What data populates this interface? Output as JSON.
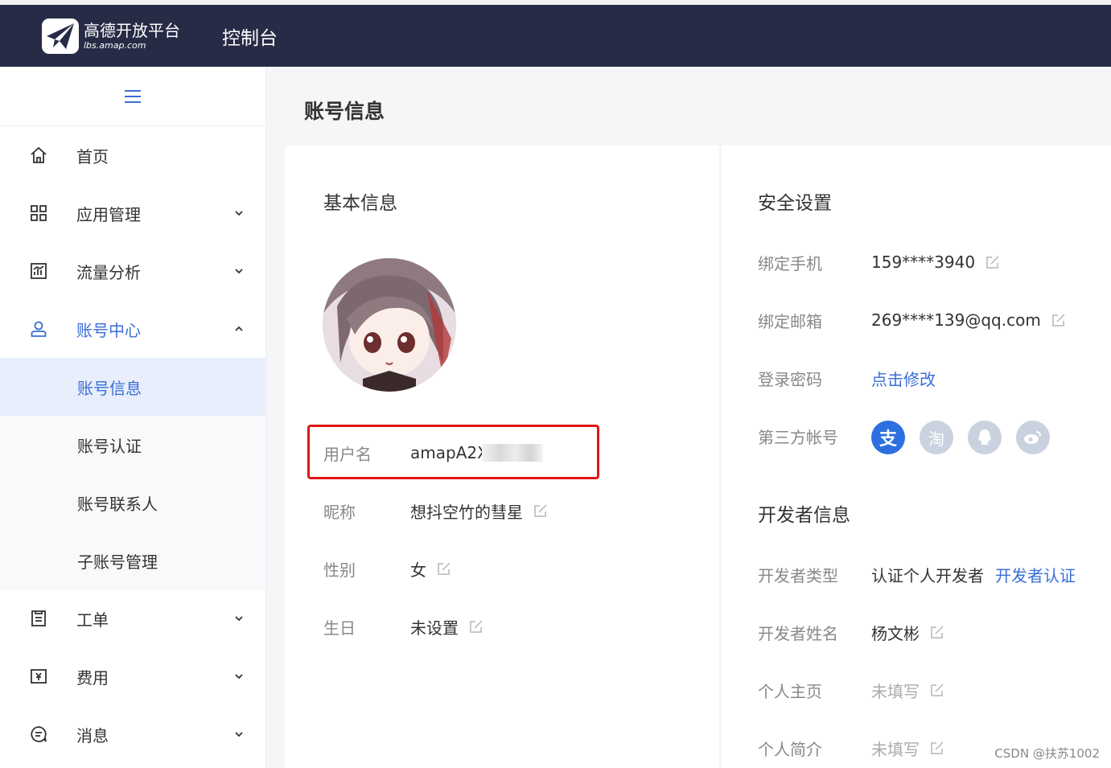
{
  "header": {
    "brand_title": "高德开放平台",
    "brand_sub": "lbs.amap.com",
    "console_label": "控制台"
  },
  "sidebar": {
    "items": [
      {
        "label": "首页"
      },
      {
        "label": "应用管理"
      },
      {
        "label": "流量分析"
      },
      {
        "label": "账号中心"
      },
      {
        "label": "工单"
      },
      {
        "label": "费用"
      },
      {
        "label": "消息"
      }
    ],
    "account_sub": [
      {
        "label": "账号信息"
      },
      {
        "label": "账号认证"
      },
      {
        "label": "账号联系人"
      },
      {
        "label": "子账号管理"
      }
    ]
  },
  "main": {
    "page_title": "账号信息",
    "basic": {
      "title": "基本信息",
      "username_label": "用户名",
      "username_value": "amapA2X",
      "nickname_label": "昵称",
      "nickname_value": "想抖空竹的彗星",
      "gender_label": "性别",
      "gender_value": "女",
      "birthday_label": "生日",
      "birthday_value": "未设置"
    },
    "security": {
      "title": "安全设置",
      "phone_label": "绑定手机",
      "phone_value": "159****3940",
      "email_label": "绑定邮箱",
      "email_value": "269****139@qq.com",
      "password_label": "登录密码",
      "password_action": "点击修改",
      "third_party_label": "第三方帐号",
      "third_party_icons": [
        "alipay-icon",
        "taobao-icon",
        "qq-icon",
        "weibo-icon"
      ],
      "alipay_glyph": "支",
      "taobao_glyph": "淘"
    },
    "developer": {
      "title": "开发者信息",
      "type_label": "开发者类型",
      "type_value": "认证个人开发者",
      "type_action": "开发者认证",
      "name_label": "开发者姓名",
      "name_value": "杨文彬",
      "homepage_label": "个人主页",
      "homepage_value": "未填写",
      "bio_label": "个人简介",
      "bio_value": "未填写"
    }
  },
  "watermark": "CSDN @扶苏1002",
  "colors": {
    "header_bg": "#272b46",
    "accent": "#3a6ed7",
    "highlight_border": "#e01616",
    "alipay": "#2e6fe0",
    "social_inactive": "#c9d2de"
  }
}
